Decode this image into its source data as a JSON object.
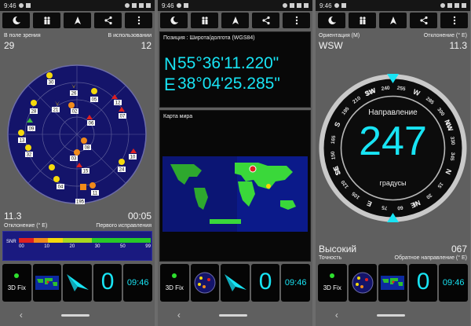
{
  "status": {
    "time": "9:46"
  },
  "screen1": {
    "in_view_label": "В поле зрения",
    "in_view_value": "29",
    "in_use_label": "В использовании",
    "in_use_value": "12",
    "deviation_value": "11.3",
    "deviation_label": "Отклонение (° E)",
    "first_fix_value": "00:05",
    "first_fix_label": "Первого исправления",
    "snr_label": "SNR",
    "snr_ticks": [
      "00",
      "10",
      "20",
      "30",
      "50",
      "99"
    ],
    "satellites": [
      "30",
      "26",
      "05",
      "12",
      "28",
      "21",
      "02",
      "09",
      "06",
      "07",
      "13",
      "32",
      "03",
      "08",
      "15",
      "10",
      "04",
      "11",
      "24",
      "23",
      "18",
      "195",
      "22"
    ]
  },
  "screen2": {
    "position_label": "Позиция : Широта/долгота (WGS84)",
    "lat_letter": "N",
    "lat_value": "55°36'11.220\"",
    "lon_letter": "E",
    "lon_value": "38°04'25.285\"",
    "map_label": "Карта мира"
  },
  "screen3": {
    "orientation_label": "Ориентация (M)",
    "orientation_value": "WSW",
    "deviation_label": "Отклонение (° E)",
    "deviation_value": "11.3",
    "heading_label": "Направление",
    "heading_value": "247",
    "degrees_label": "градусы",
    "accuracy_value": "Высокий",
    "accuracy_label": "Точность",
    "back_value": "067",
    "back_label": "Обратное направление (° E)",
    "compass_ticks": [
      "240",
      "255",
      "285",
      "300",
      "315",
      "330",
      "345",
      "15",
      "30",
      "45",
      "60",
      "75",
      "105",
      "120",
      "135",
      "150",
      "165",
      "195",
      "210",
      "225"
    ],
    "compass_dirs": [
      "SW",
      "W",
      "NW",
      "N",
      "NE",
      "E",
      "SE",
      "S"
    ]
  },
  "tiles": {
    "fix_label": "3D Fix",
    "big_digit": "0",
    "clock": "09:46"
  },
  "nav": {
    "back": "‹"
  }
}
